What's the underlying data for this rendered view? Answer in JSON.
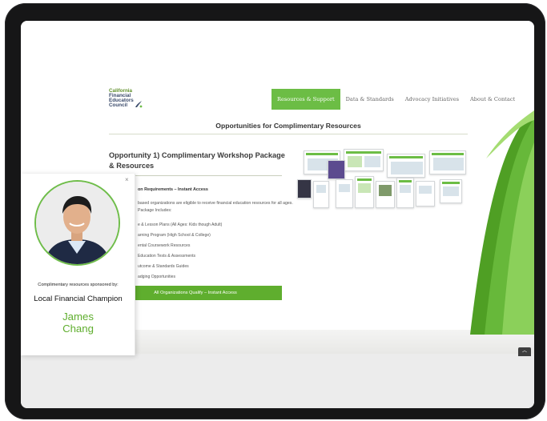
{
  "logo": {
    "name": "logo",
    "lines": [
      "California",
      "Financial",
      "Educators",
      "Council"
    ]
  },
  "nav": {
    "items": [
      {
        "label": "Resources & Support",
        "active": true
      },
      {
        "label": "Data & Standards",
        "active": false
      },
      {
        "label": "Advocacy Initiatives",
        "active": false
      },
      {
        "label": "About & Contact",
        "active": false
      }
    ]
  },
  "main": {
    "section_title": "Opportunities for Complimentary Resources",
    "opportunity_title": "Opportunity 1) Complimentary Workshop Package & Resources",
    "requirements_title": "on Requirements – Instant Access",
    "description": "based organizations are eligible to receive financial education resources for all ages. Package Includes:",
    "package_items": [
      "e & Lesson Plans (All Ages: Kids though Adult)",
      "arning Program (High School & College)",
      "ental Coursework Resources",
      "Education Tests & Assessments",
      "utcome & Standards Guides",
      "adging Opportunities"
    ],
    "cta_label": "All Organizations Qualify – Instant Access"
  },
  "sponsor_popup": {
    "close_symbol": "×",
    "label": "Complimentary resources sponsored by:",
    "title": "Local Financial Champion",
    "name_first": "James",
    "name_last": "Chang"
  },
  "scroll_top_symbol": "︿",
  "colors": {
    "accent_green": "#6cbd45",
    "cta_green": "#5fae2e",
    "tablet_frame": "#161617"
  },
  "icons": {
    "close": "close-icon",
    "scroll_top": "chevron-up-icon"
  }
}
